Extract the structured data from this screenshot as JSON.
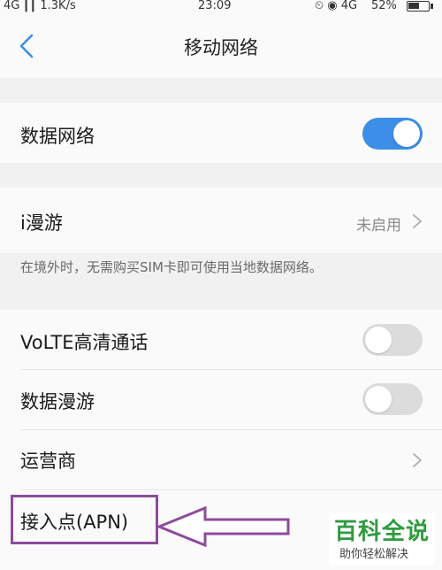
{
  "status_bar": {
    "signal": "4G ┃┃ 1.3K/s",
    "time": "23:09",
    "icons": "⏲ ◉ 4G",
    "battery": "52%"
  },
  "header": {
    "title": "移动网络"
  },
  "rows": {
    "data_network": {
      "label": "数据网络",
      "on": true
    },
    "i_roaming": {
      "label": "i漫游",
      "value": "未启用"
    },
    "roaming_hint": "在境外时，无需购买SIM卡即可使用当地数据网络。",
    "volte": {
      "label": "VoLTE高清通话",
      "on": false
    },
    "data_roaming": {
      "label": "数据漫游",
      "on": false
    },
    "carrier": {
      "label": "运营商"
    },
    "apn": {
      "label": "接入点(APN)"
    }
  },
  "colors": {
    "accent": "#3d8ee6",
    "annotation": "#8e4b9c",
    "watermark": "#2f9b3f"
  },
  "watermark": {
    "title": "百科全说",
    "subtitle": "助你轻松解决"
  }
}
